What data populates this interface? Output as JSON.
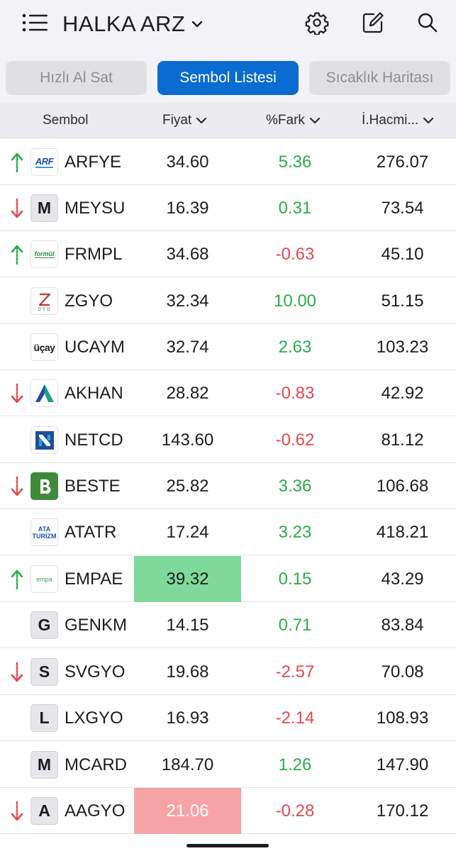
{
  "app": {
    "title": "HALKA ARZ"
  },
  "tabs": [
    {
      "label": "Hızlı Al Sat",
      "active": false
    },
    {
      "label": "Sembol Listesi",
      "active": true
    },
    {
      "label": "Sıcaklık Haritası",
      "active": false
    }
  ],
  "columns": {
    "symbol": "Sembol",
    "price": "Fiyat",
    "diff": "%Fark",
    "volume": "İ.Hacmi..."
  },
  "colors": {
    "accent": "#0a6bd1",
    "up": "#27ae48",
    "down": "#e5484d",
    "flash_up": "#7fd99a",
    "flash_down": "#f7a3a5"
  },
  "rows": [
    {
      "symbol": "ARFYE",
      "price": "34.60",
      "diff": "5.36",
      "volume": "276.07",
      "trend": "up",
      "logo": "ARF"
    },
    {
      "symbol": "MEYSU",
      "price": "16.39",
      "diff": "0.31",
      "volume": "73.54",
      "trend": "down",
      "logo": "M"
    },
    {
      "symbol": "FRMPL",
      "price": "34.68",
      "diff": "-0.63",
      "volume": "45.10",
      "trend": "up",
      "logo": "formül"
    },
    {
      "symbol": "ZGYO",
      "price": "32.34",
      "diff": "10.00",
      "volume": "51.15",
      "trend": "none",
      "logo": "Z GYO"
    },
    {
      "symbol": "UCAYM",
      "price": "32.74",
      "diff": "2.63",
      "volume": "103.23",
      "trend": "none",
      "logo": "üçay"
    },
    {
      "symbol": "AKHAN",
      "price": "28.82",
      "diff": "-0.83",
      "volume": "42.92",
      "trend": "down",
      "logo": "akhan-logo"
    },
    {
      "symbol": "NETCD",
      "price": "143.60",
      "diff": "-0.62",
      "volume": "81.12",
      "trend": "none",
      "logo": "netcd-logo"
    },
    {
      "symbol": "BESTE",
      "price": "25.82",
      "diff": "3.36",
      "volume": "106.68",
      "trend": "down",
      "logo": "beste-logo"
    },
    {
      "symbol": "ATATR",
      "price": "17.24",
      "diff": "3.23",
      "volume": "418.21",
      "trend": "none",
      "logo": "ATA TURİZM"
    },
    {
      "symbol": "EMPAE",
      "price": "39.32",
      "diff": "0.15",
      "volume": "43.29",
      "trend": "up",
      "logo": "empa",
      "highlight": "up"
    },
    {
      "symbol": "GENKM",
      "price": "14.15",
      "diff": "0.71",
      "volume": "83.84",
      "trend": "none",
      "logo": "G"
    },
    {
      "symbol": "SVGYO",
      "price": "19.68",
      "diff": "-2.57",
      "volume": "70.08",
      "trend": "down",
      "logo": "S"
    },
    {
      "symbol": "LXGYO",
      "price": "16.93",
      "diff": "-2.14",
      "volume": "108.93",
      "trend": "none",
      "logo": "L"
    },
    {
      "symbol": "MCARD",
      "price": "184.70",
      "diff": "1.26",
      "volume": "147.90",
      "trend": "none",
      "logo": "M"
    },
    {
      "symbol": "AAGYO",
      "price": "21.06",
      "diff": "-0.28",
      "volume": "170.12",
      "trend": "down",
      "logo": "A",
      "highlight": "down"
    }
  ]
}
